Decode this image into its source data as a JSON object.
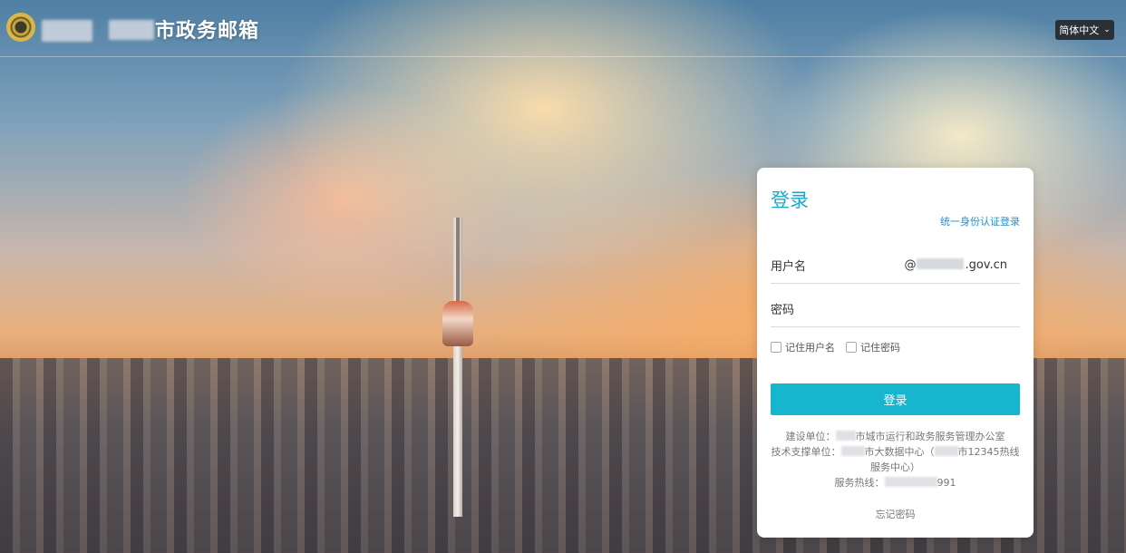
{
  "header": {
    "title": "市政务邮箱",
    "language": "简体中文"
  },
  "login": {
    "title": "登录",
    "unified_auth_link": "统一身份认证登录",
    "username_label": "用户名",
    "domain_prefix": "@",
    "domain_suffix": ".gov.cn",
    "password_label": "密码",
    "remember_username": "记住用户名",
    "remember_password": "记住密码",
    "submit_label": "登录",
    "forgot_password": "忘记密码"
  },
  "info": {
    "builder_prefix": "建设单位：",
    "builder_name": "市城市运行和政务服务管理办公室",
    "support_prefix": "技术支撑单位：",
    "support_name_1": "市大数据中心（",
    "support_name_2": "市12345热线",
    "support_name_3": "服务中心）",
    "hotline_prefix": "服务热线：",
    "hotline_suffix": "991"
  },
  "icons": {
    "logo": "emblem-logo",
    "lang_chevron": "chevron-down-icon"
  }
}
